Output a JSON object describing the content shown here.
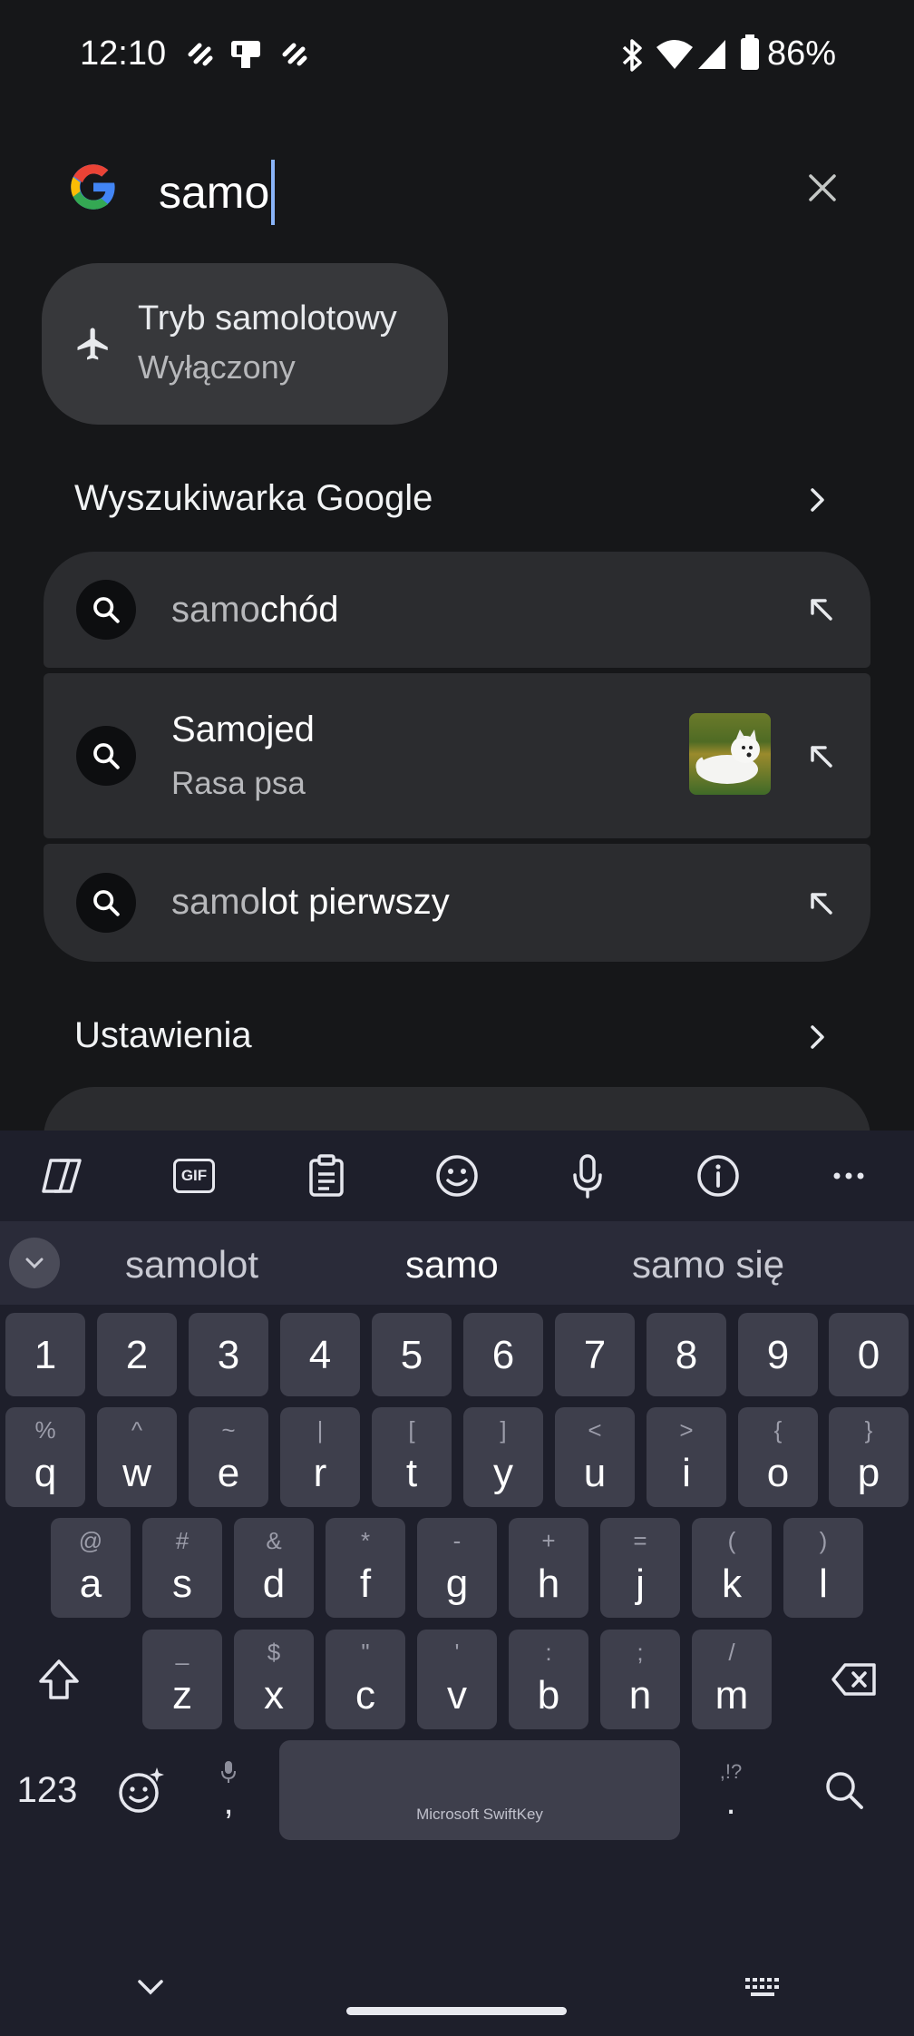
{
  "status_bar": {
    "time": "12:10",
    "battery_percent": "86%",
    "icons": [
      "notification-icon",
      "notification-icon",
      "notification-icon",
      "bluetooth-icon",
      "wifi-icon",
      "signal-icon",
      "battery-icon"
    ]
  },
  "search": {
    "logo": "google-g-logo",
    "query": "samo",
    "clear_icon": "close-icon"
  },
  "quick_setting": {
    "icon": "airplane-icon",
    "title": "Tryb samolotowy",
    "status": "Wyłączony"
  },
  "google_section": {
    "title": "Wyszukiwarka Google",
    "chevron": "chevron-right-icon"
  },
  "suggestions": [
    {
      "prefix": "samo",
      "rest": "chód",
      "icon": "search-icon",
      "action": "fill-arrow-icon"
    },
    {
      "title": "Samojed",
      "subtitle": "Rasa psa",
      "icon": "search-icon",
      "action": "fill-arrow-icon",
      "thumbnail": "samoyed-dog-image"
    },
    {
      "prefix": "samo",
      "rest": "lot pierwszy",
      "icon": "search-icon",
      "action": "fill-arrow-icon"
    }
  ],
  "settings_section": {
    "title": "Ustawienia",
    "chevron": "chevron-right-icon"
  },
  "keyboard": {
    "toolbar": [
      "copilot-icon",
      "gif-icon",
      "clipboard-icon",
      "emoji-icon",
      "mic-icon",
      "info-icon",
      "more-icon"
    ],
    "gif_label": "GIF",
    "predictions": [
      "samolot",
      "samo",
      "samo się"
    ],
    "number_row": [
      "1",
      "2",
      "3",
      "4",
      "5",
      "6",
      "7",
      "8",
      "9",
      "0"
    ],
    "row1": [
      {
        "main": "q",
        "sup": "%"
      },
      {
        "main": "w",
        "sup": "^"
      },
      {
        "main": "e",
        "sup": "~"
      },
      {
        "main": "r",
        "sup": "|"
      },
      {
        "main": "t",
        "sup": "["
      },
      {
        "main": "y",
        "sup": "]"
      },
      {
        "main": "u",
        "sup": "<"
      },
      {
        "main": "i",
        "sup": ">"
      },
      {
        "main": "o",
        "sup": "{"
      },
      {
        "main": "p",
        "sup": "}"
      }
    ],
    "row2": [
      {
        "main": "a",
        "sup": "@"
      },
      {
        "main": "s",
        "sup": "#"
      },
      {
        "main": "d",
        "sup": "&"
      },
      {
        "main": "f",
        "sup": "*"
      },
      {
        "main": "g",
        "sup": "-"
      },
      {
        "main": "h",
        "sup": "+"
      },
      {
        "main": "j",
        "sup": "="
      },
      {
        "main": "k",
        "sup": "("
      },
      {
        "main": "l",
        "sup": ")"
      }
    ],
    "row3": [
      {
        "main": "z",
        "sup": "_"
      },
      {
        "main": "x",
        "sup": "$"
      },
      {
        "main": "c",
        "sup": "\""
      },
      {
        "main": "v",
        "sup": "'"
      },
      {
        "main": "b",
        "sup": ":"
      },
      {
        "main": "n",
        "sup": ";"
      },
      {
        "main": "m",
        "sup": "/"
      }
    ],
    "num_label": "123",
    "comma": ",",
    "period": ".",
    "period_sup": ",!?",
    "space_label": "Microsoft SwiftKey"
  }
}
